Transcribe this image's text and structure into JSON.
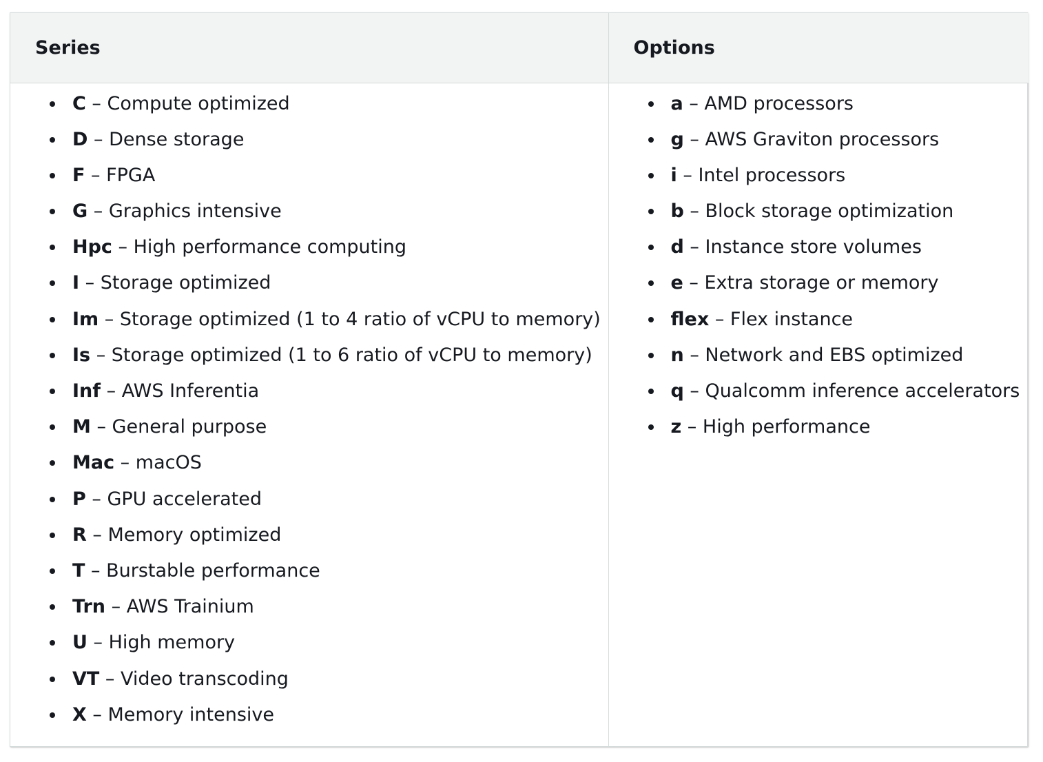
{
  "table": {
    "headers": {
      "series": "Series",
      "options": "Options"
    },
    "separator": " – ",
    "series": [
      {
        "code": "C",
        "desc": "Compute optimized"
      },
      {
        "code": "D",
        "desc": "Dense storage"
      },
      {
        "code": "F",
        "desc": "FPGA"
      },
      {
        "code": "G",
        "desc": "Graphics intensive"
      },
      {
        "code": "Hpc",
        "desc": "High performance computing"
      },
      {
        "code": "I",
        "desc": "Storage optimized"
      },
      {
        "code": "Im",
        "desc": "Storage optimized (1 to 4 ratio of vCPU to memory)"
      },
      {
        "code": "Is",
        "desc": "Storage optimized (1 to 6 ratio of vCPU to memory)"
      },
      {
        "code": "Inf",
        "desc": "AWS Inferentia"
      },
      {
        "code": "M",
        "desc": "General purpose"
      },
      {
        "code": "Mac",
        "desc": "macOS"
      },
      {
        "code": "P",
        "desc": "GPU accelerated"
      },
      {
        "code": "R",
        "desc": "Memory optimized"
      },
      {
        "code": "T",
        "desc": "Burstable performance"
      },
      {
        "code": "Trn",
        "desc": "AWS Trainium"
      },
      {
        "code": "U",
        "desc": "High memory"
      },
      {
        "code": "VT",
        "desc": "Video transcoding"
      },
      {
        "code": "X",
        "desc": "Memory intensive"
      }
    ],
    "options": [
      {
        "code": "a",
        "desc": "AMD processors"
      },
      {
        "code": "g",
        "desc": "AWS Graviton processors"
      },
      {
        "code": "i",
        "desc": "Intel processors"
      },
      {
        "code": "b",
        "desc": "Block storage optimization"
      },
      {
        "code": "d",
        "desc": "Instance store volumes"
      },
      {
        "code": "e",
        "desc": "Extra storage or memory"
      },
      {
        "code": "flex",
        "desc": "Flex instance"
      },
      {
        "code": "n",
        "desc": "Network and EBS optimized"
      },
      {
        "code": "q",
        "desc": "Qualcomm inference accelerators"
      },
      {
        "code": "z",
        "desc": "High performance"
      }
    ]
  }
}
